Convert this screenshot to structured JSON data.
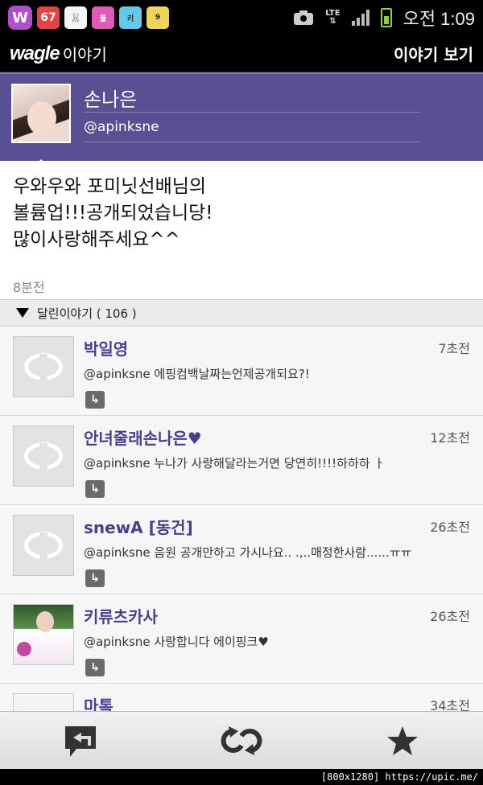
{
  "status_bar": {
    "notifications": [
      "wagle-icon",
      "badge-67-icon",
      "rabbit-icon",
      "flower-icon",
      "kira-icon",
      "month-icon"
    ],
    "badge_67": "67",
    "lte": "LTE",
    "time": "오전 1:09",
    "colors": {
      "battery": "#8cd23c"
    }
  },
  "header": {
    "brand": "wagle",
    "brand_sub": "이야기",
    "title": "이야기 보기"
  },
  "profile": {
    "name": "손나은",
    "handle": "@apinksne"
  },
  "post": {
    "text": "우와우와 포미닛선배님의\n볼륨업!!!공개되었습니당!\n 많이사랑해주세요^^",
    "time": "8분전"
  },
  "comments_header": {
    "label": "달린이야기 ( 106 )"
  },
  "comments": [
    {
      "name": "박일영",
      "time": "7초전",
      "text": "@apinksne 에핑컴백날짜는언제공개되요?!",
      "avatar": "default"
    },
    {
      "name": "안녀줄래손나은♥",
      "time": "12초전",
      "text": "@apinksne 누나가 사랑해달라는거면 당연히!!!!하하하 ㅏ",
      "avatar": "default"
    },
    {
      "name": "snewA [동건]",
      "time": "26초전",
      "text": "@apinksne 음원 공개만하고 가시나요.. .,..매정한사람......ㅠㅠ",
      "avatar": "default"
    },
    {
      "name": "키류츠카사",
      "time": "26초전",
      "text": "@apinksne 사랑합니다 에이핑크♥",
      "avatar": "photo1"
    },
    {
      "name": "마톡",
      "time": "34초전",
      "text": "",
      "avatar": "photo2"
    }
  ],
  "toolbar": {
    "buttons": [
      "reply-icon",
      "refresh-icon",
      "star-icon"
    ]
  },
  "watermark": "[800x1280] https://upic.me/"
}
